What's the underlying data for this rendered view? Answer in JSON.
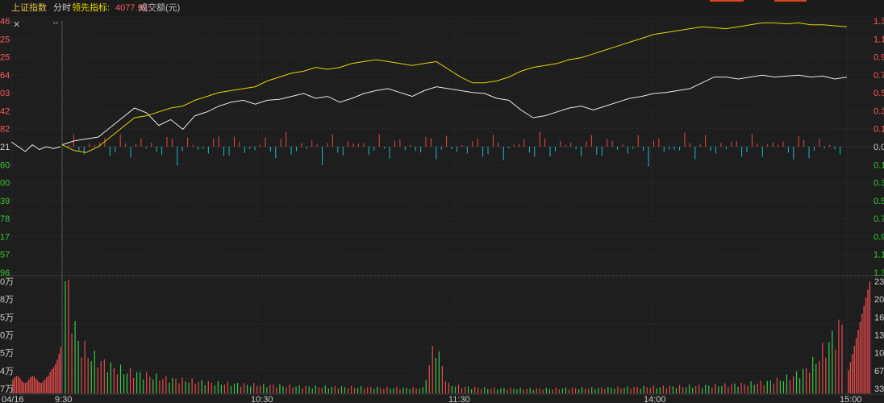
{
  "header": {
    "title": "上证指数",
    "tab": "分时",
    "leading_label": "领先指标:",
    "leading_value": "4077.99",
    "volume_label": "成交额(元)"
  },
  "icons": {
    "close": "close-icon",
    "expand": "expand-arrows-icon"
  },
  "colors": {
    "price_line": "#e8e8e8",
    "leading_line": "#e6d200",
    "up": "#e84a4a",
    "down": "#1fb8c8",
    "volume_up": "#e84a4a",
    "volume_down": "#39c94a",
    "grid": "#2f2f2f",
    "label_up": "#ff5a5a",
    "label_down": "#36c936"
  },
  "chart_data": {
    "type": "line",
    "price_axis_left": {
      "ticks": [
        "46",
        "25",
        "25",
        "64",
        "03",
        "42",
        "82",
        "21",
        "60",
        "00",
        "39",
        "78",
        "17",
        "57",
        "96"
      ]
    },
    "price_axis_right": {
      "ticks": [
        "1.3",
        "1.1",
        "0.9",
        "0.7",
        "0.5",
        "0.3",
        "0.1",
        "0.0",
        "0.1",
        "0.3",
        "0.5",
        "0.7",
        "0.9",
        "1.1",
        "1.3"
      ]
    },
    "volume_axis_left": {
      "ticks": [
        "0万",
        "8万",
        "5万",
        "0万",
        "5万",
        "4万",
        "7万"
      ]
    },
    "volume_axis_right": {
      "ticks": [
        "23",
        "20",
        "16",
        "13",
        "10",
        "67",
        "33"
      ]
    },
    "time_axis": [
      "04/16",
      "9:30",
      "10:30",
      "11:30",
      "14:00",
      "15:00"
    ],
    "prev_day_tail": [
      0.05,
      0.0,
      -0.05,
      0.02,
      -0.03,
      0.0,
      -0.02,
      0.0
    ],
    "series": [
      {
        "key": "index",
        "values": [
          0.02,
          0.06,
          0.08,
          0.1,
          0.2,
          0.3,
          0.4,
          0.35,
          0.22,
          0.28,
          0.18,
          0.32,
          0.36,
          0.42,
          0.46,
          0.48,
          0.44,
          0.48,
          0.49,
          0.52,
          0.55,
          0.5,
          0.52,
          0.46,
          0.5,
          0.55,
          0.58,
          0.6,
          0.56,
          0.52,
          0.58,
          0.62,
          0.6,
          0.58,
          0.56,
          0.55,
          0.5,
          0.48,
          0.38,
          0.3,
          0.32,
          0.36,
          0.4,
          0.42,
          0.38,
          0.42,
          0.46,
          0.5,
          0.52,
          0.55,
          0.56,
          0.58,
          0.6,
          0.66,
          0.72,
          0.72,
          0.7,
          0.72,
          0.74,
          0.72,
          0.73,
          0.74,
          0.72,
          0.73,
          0.7,
          0.72
        ]
      },
      {
        "key": "leading",
        "values": [
          0.02,
          -0.04,
          -0.06,
          0.0,
          0.1,
          0.2,
          0.3,
          0.32,
          0.36,
          0.4,
          0.42,
          0.48,
          0.52,
          0.56,
          0.58,
          0.6,
          0.62,
          0.68,
          0.72,
          0.76,
          0.78,
          0.82,
          0.8,
          0.82,
          0.86,
          0.88,
          0.9,
          0.88,
          0.86,
          0.84,
          0.86,
          0.88,
          0.8,
          0.72,
          0.66,
          0.66,
          0.68,
          0.72,
          0.78,
          0.82,
          0.84,
          0.86,
          0.9,
          0.92,
          0.96,
          1.0,
          1.04,
          1.08,
          1.12,
          1.16,
          1.18,
          1.2,
          1.22,
          1.24,
          1.23,
          1.22,
          1.24,
          1.26,
          1.28,
          1.28,
          1.27,
          1.28,
          1.26,
          1.26,
          1.25,
          1.24
        ]
      }
    ],
    "volume_profile": [
      1.0,
      0.45,
      0.33,
      0.27,
      0.22,
      0.19,
      0.17,
      0.15,
      0.13,
      0.12,
      0.11,
      0.1,
      0.09,
      0.085,
      0.08,
      0.075,
      0.07,
      0.068,
      0.065,
      0.06,
      0.058,
      0.056,
      0.055,
      0.053,
      0.052,
      0.05,
      0.048,
      0.047,
      0.046,
      0.045,
      0.44,
      0.08,
      0.06,
      0.05,
      0.045,
      0.043,
      0.042,
      0.041,
      0.04,
      0.04,
      0.042,
      0.043,
      0.045,
      0.046,
      0.048,
      0.05,
      0.052,
      0.054,
      0.056,
      0.058,
      0.06,
      0.063,
      0.066,
      0.07,
      0.075,
      0.08,
      0.09,
      0.1,
      0.12,
      0.15,
      0.2,
      0.3,
      0.45,
      0.6
    ],
    "ylim": [
      -1.3,
      1.3
    ]
  }
}
